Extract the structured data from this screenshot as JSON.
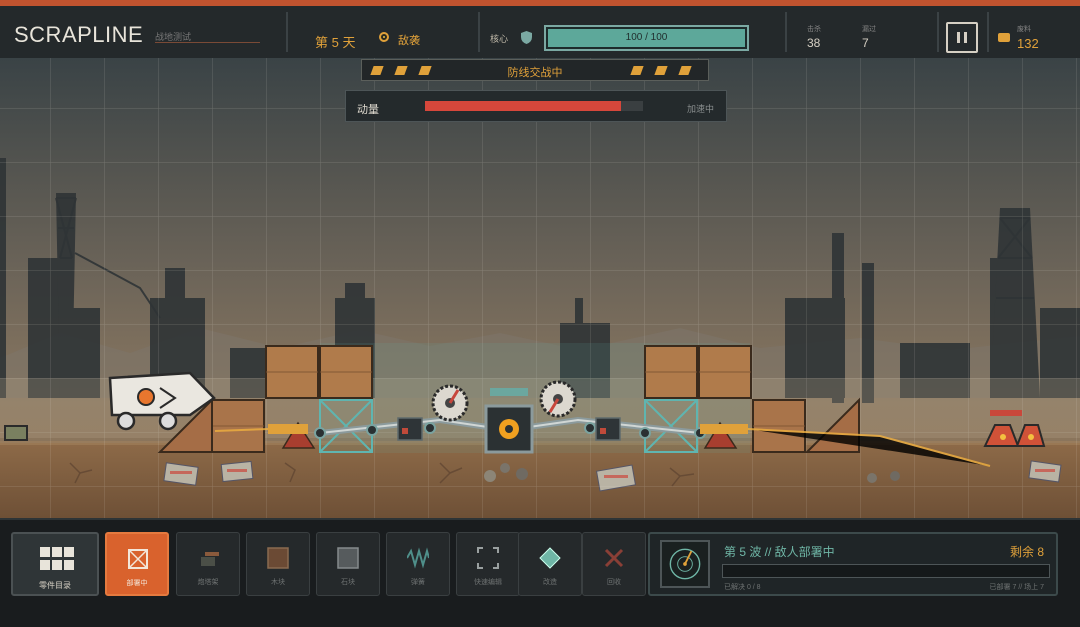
{
  "topbar": {
    "title": "SCRAPLINE",
    "subtitle": "战地测试",
    "day": "第 5 天",
    "phase": "敌袭",
    "core_label": "核心",
    "core_hp": "100 / 100",
    "core_hp_fraction": 1.0,
    "stats": [
      {
        "label": "击杀",
        "value": "38"
      },
      {
        "label": "漏过",
        "value": "7"
      }
    ],
    "resource_label": "废料",
    "resource_value": "132",
    "colors": {
      "accent": "#e0a13a",
      "alert": "#c0532f",
      "hp": "#5da89a"
    }
  },
  "hud": {
    "banner": "防线交战中",
    "momentum_label": "动量",
    "momentum_state": "加速中",
    "momentum_fraction": 0.9
  },
  "toolbar": {
    "catalog_label": "零件目录",
    "slots": [
      {
        "label": "部署中",
        "sub": "",
        "icon": "frame-icon"
      },
      {
        "label": "炮塔架",
        "sub": "",
        "icon": "turret-icon"
      },
      {
        "label": "木块",
        "sub": "",
        "icon": "wood-block-icon"
      },
      {
        "label": "石块",
        "sub": "",
        "icon": "stone-block-icon"
      },
      {
        "label": "弹簧",
        "sub": "",
        "icon": "spring-icon"
      },
      {
        "label": "快速编辑",
        "sub": "",
        "icon": "select-icon"
      },
      {
        "label": "改造",
        "sub": "",
        "icon": "crystal-icon"
      },
      {
        "label": "回收",
        "sub": "",
        "icon": "delete-icon"
      }
    ]
  },
  "wave": {
    "title": "第 5 波 // 敌人部署中",
    "remaining": "剩余 8",
    "progress_left": "已解决 0 / 8",
    "progress_right": "已部署 7 // 场上 7",
    "progress_fraction": 0.0
  }
}
